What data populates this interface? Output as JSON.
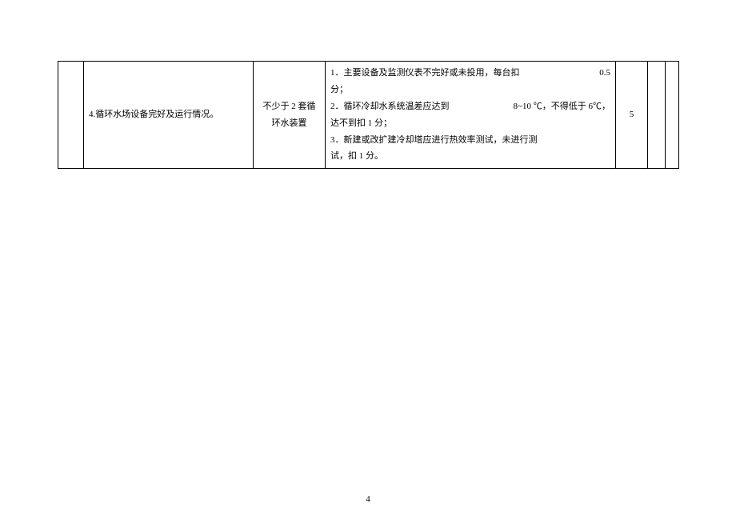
{
  "row": {
    "col0": "",
    "desc": "4.循环水场设备完好及运行情况。",
    "scope_line1": "不少于 2 套循",
    "scope_line2": "环水装置",
    "crit1_lead": "1．主要设备及监测仪表不完好或未投用，每台扣",
    "crit1_tail": "0.5",
    "crit1b": "分；",
    "crit2_lead": "2．循环冷却水系统温差应达到",
    "crit2_mid": "8~10 ℃，不得低于 6℃，",
    "crit2b": "达不到扣 1 分；",
    "crit3a": "3．新建或改扩建冷却塔应进行热效率测试，未进行测",
    "crit3b": "试，扣 1 分。",
    "score": "5",
    "col5": "",
    "col6": ""
  },
  "page_number": "4"
}
